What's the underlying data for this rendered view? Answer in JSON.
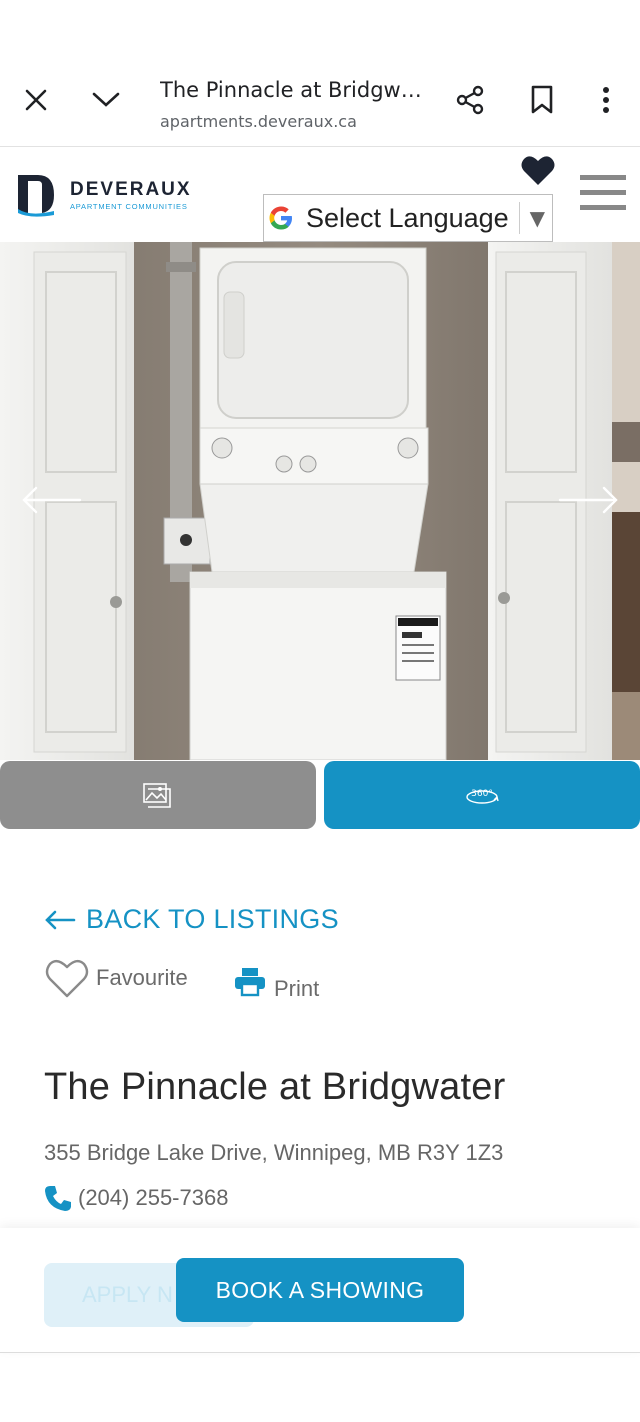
{
  "browser": {
    "page_title": "The Pinnacle at Bridgwat...",
    "url": "apartments.deveraux.ca",
    "icons": [
      "close-icon",
      "chevron-down-icon",
      "share-icon",
      "bookmark-icon",
      "more-vert-icon"
    ]
  },
  "header": {
    "brand_name": "DEVERAUX",
    "brand_tagline": "APARTMENT COMMUNITIES",
    "language_select": "Select Language"
  },
  "colors": {
    "accent": "#1592c4",
    "photo_tab": "#8e8e8e",
    "dark": "#1d2433"
  },
  "listing": {
    "back_link": "BACK TO LISTINGS",
    "favourite": "Favourite",
    "print": "Print",
    "name": "The Pinnacle at Bridgwater",
    "address": "355 Bridge Lake Drive, Winnipeg, MB R3Y 1Z3",
    "phone": "(204) 255-7368"
  },
  "actions": {
    "apply_partial": "APPLY N",
    "book": "BOOK A SHOWING"
  }
}
